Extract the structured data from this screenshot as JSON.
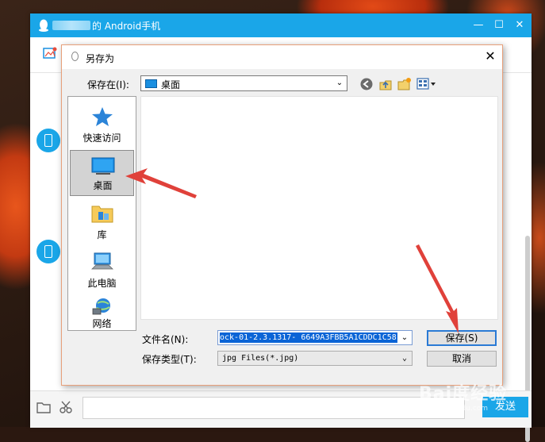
{
  "qq_window": {
    "title": "的 Android手机",
    "send_label": "发送",
    "colors": {
      "titlebar": "#1aa6e8"
    }
  },
  "dialog": {
    "title": "另存为",
    "save_in_label": "保存在(I):",
    "location": "桌面",
    "places": [
      {
        "label": "快速访问",
        "icon": "star-icon"
      },
      {
        "label": "桌面",
        "icon": "desktop-icon",
        "selected": true
      },
      {
        "label": "库",
        "icon": "library-folder-icon"
      },
      {
        "label": "此电脑",
        "icon": "computer-icon"
      },
      {
        "label": "网络",
        "icon": "network-globe-icon"
      }
    ],
    "filename_label": "文件名(N):",
    "filename_value": "ock-01-2.3.1317- 6649A3FBB5A1CDDC1C58",
    "filetype_label": "保存类型(T):",
    "filetype_value": "jpg Files(*.jpg)",
    "save_button": "保存(S)",
    "cancel_button": "取消"
  },
  "watermark": {
    "main": "Bai度经验",
    "sub": "jingyan.baidu.com"
  }
}
